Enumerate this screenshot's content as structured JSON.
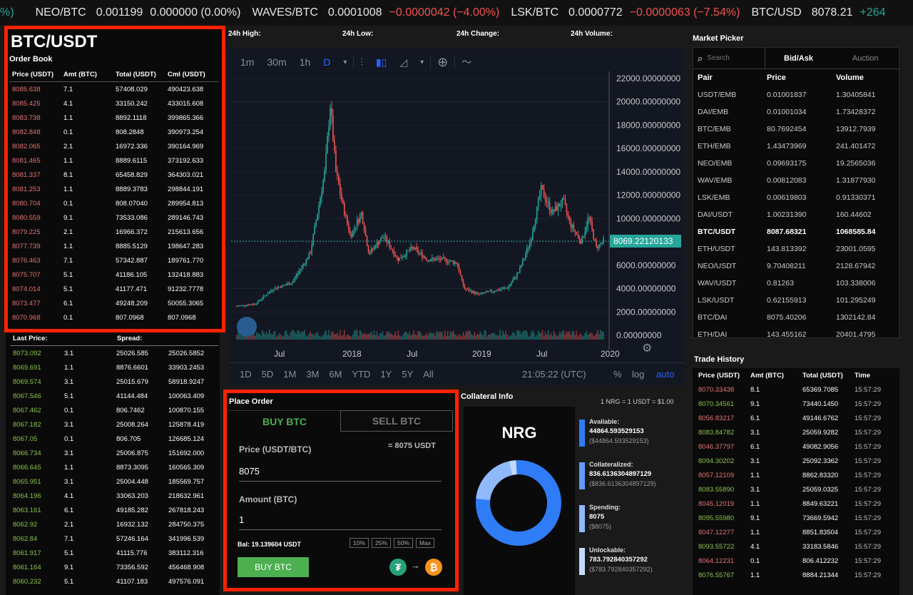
{
  "ticker": [
    {
      "pair": "%)",
      "price": "",
      "change": "",
      "dir": "pos"
    },
    {
      "pair": "NEO/BTC",
      "price": "0.001199",
      "change": "0.000000 (0.00%)",
      "dir": "zero"
    },
    {
      "pair": "WAVES/BTC",
      "price": "0.0001008",
      "change": "−0.0000042 (−4.00%)",
      "dir": "neg"
    },
    {
      "pair": "LSK/BTC",
      "price": "0.0000772",
      "change": "−0.0000063 (−7.54%)",
      "dir": "neg"
    },
    {
      "pair": "BTC/USD",
      "price": "8078.21",
      "change": "+264",
      "dir": "pos"
    }
  ],
  "pair_title": "BTC/USDT",
  "orderbook": {
    "title": "Order Book",
    "headers": [
      "Price (USDT)",
      "Amt (BTC)",
      "Total (USDT)",
      "Cml (USDT)"
    ],
    "asks": [
      [
        "8085.638",
        "7.1",
        "57408.029",
        "490423.638"
      ],
      [
        "8085.425",
        "4.1",
        "33150.242",
        "433015.608"
      ],
      [
        "8083.738",
        "1.1",
        "8892.1118",
        "399865.366"
      ],
      [
        "8082.848",
        "0.1",
        "808.2848",
        "390973.254"
      ],
      [
        "8082.065",
        "2.1",
        "16972.336",
        "390164.969"
      ],
      [
        "8081.465",
        "1.1",
        "8889.6115",
        "373192.633"
      ],
      [
        "8081.337",
        "8.1",
        "65458.829",
        "364303.021"
      ],
      [
        "8081.253",
        "1.1",
        "8889.3783",
        "298844.191"
      ],
      [
        "8080.704",
        "0.1",
        "808.07040",
        "289954.813"
      ],
      [
        "8080.559",
        "9.1",
        "73533.086",
        "289146.743"
      ],
      [
        "8079.225",
        "2.1",
        "16966.372",
        "215613.656"
      ],
      [
        "8077.739",
        "1.1",
        "8885.5129",
        "198647.283"
      ],
      [
        "8076.463",
        "7.1",
        "57342.887",
        "189761.770"
      ],
      [
        "8075.707",
        "5.1",
        "41186.105",
        "132418.883"
      ],
      [
        "8074.014",
        "5.1",
        "41177.471",
        "91232.7778"
      ],
      [
        "8073.477",
        "6.1",
        "49248.209",
        "50055.3065"
      ],
      [
        "8070.968",
        "0.1",
        "807.0968",
        "807.0968"
      ]
    ],
    "last_price_label": "Last Price:",
    "spread_label": "Spread:",
    "bids": [
      [
        "8073.092",
        "3.1",
        "25026.585",
        "25026.5852"
      ],
      [
        "8069.691",
        "1.1",
        "8876.6601",
        "33903.2453"
      ],
      [
        "8069.574",
        "3.1",
        "25015.679",
        "58918.9247"
      ],
      [
        "8067.546",
        "5.1",
        "41144.484",
        "100063.409"
      ],
      [
        "8067.462",
        "0.1",
        "806.7462",
        "100870.155"
      ],
      [
        "8067.182",
        "3.1",
        "25008.264",
        "125878.419"
      ],
      [
        "8067.05",
        "0.1",
        "806.705",
        "126685.124"
      ],
      [
        "8066.734",
        "3.1",
        "25006.875",
        "151692.000"
      ],
      [
        "8066.645",
        "1.1",
        "8873.3095",
        "160565.309"
      ],
      [
        "8065.951",
        "3.1",
        "25004.448",
        "185569.757"
      ],
      [
        "8064.196",
        "4.1",
        "33063.203",
        "218632.961"
      ],
      [
        "8063.161",
        "6.1",
        "49185.282",
        "267818.243"
      ],
      [
        "8062.92",
        "2.1",
        "16932.132",
        "284750.375"
      ],
      [
        "8062.84",
        "7.1",
        "57246.164",
        "341996.539"
      ],
      [
        "8061.917",
        "5.1",
        "41115.776",
        "383112.316"
      ],
      [
        "8061.164",
        "9.1",
        "73356.592",
        "456468.908"
      ],
      [
        "8060.232",
        "5.1",
        "41107.183",
        "497576.091"
      ]
    ]
  },
  "stats": {
    "high": "24h High:",
    "low": "24h Low:",
    "change": "24h Change:",
    "volume": "24h Volume:"
  },
  "chart_toolbar": {
    "intervals": [
      "1m",
      "30m",
      "1h",
      "D"
    ]
  },
  "chart_bottom": {
    "ranges": [
      "1D",
      "5D",
      "1M",
      "3M",
      "6M",
      "YTD",
      "1Y",
      "5Y",
      "All"
    ],
    "time": "21:05:22 (UTC)",
    "pct": "%",
    "log": "log",
    "auto": "auto"
  },
  "chart_data": {
    "type": "candlestick",
    "x_ticks": [
      "Jul",
      "2018",
      "Jul",
      "2019",
      "Jul",
      "2020"
    ],
    "y_ticks": [
      "22000.00000000",
      "20000.00000000",
      "18000.00000000",
      "16000.00000000",
      "14000.00000000",
      "12000.00000000",
      "10000.00000000",
      "8000.00000000",
      "6000.00000000",
      "4000.00000000",
      "2000.00000000",
      "0.00000000"
    ],
    "ylim": [
      0,
      22000
    ],
    "last_price": "8069.22120133",
    "last_price_value": 8069.22,
    "series_approx": [
      {
        "t": 0.0,
        "p": 2500
      },
      {
        "t": 0.05,
        "p": 2700
      },
      {
        "t": 0.1,
        "p": 4000
      },
      {
        "t": 0.15,
        "p": 4500
      },
      {
        "t": 0.2,
        "p": 7000
      },
      {
        "t": 0.24,
        "p": 14000
      },
      {
        "t": 0.255,
        "p": 19800
      },
      {
        "t": 0.27,
        "p": 14000
      },
      {
        "t": 0.29,
        "p": 11000
      },
      {
        "t": 0.31,
        "p": 8500
      },
      {
        "t": 0.34,
        "p": 10500
      },
      {
        "t": 0.36,
        "p": 7000
      },
      {
        "t": 0.4,
        "p": 8500
      },
      {
        "t": 0.44,
        "p": 6500
      },
      {
        "t": 0.48,
        "p": 7500
      },
      {
        "t": 0.52,
        "p": 6500
      },
      {
        "t": 0.56,
        "p": 6500
      },
      {
        "t": 0.6,
        "p": 6200
      },
      {
        "t": 0.62,
        "p": 4000
      },
      {
        "t": 0.66,
        "p": 3500
      },
      {
        "t": 0.7,
        "p": 3800
      },
      {
        "t": 0.74,
        "p": 4100
      },
      {
        "t": 0.77,
        "p": 5500
      },
      {
        "t": 0.8,
        "p": 8000
      },
      {
        "t": 0.83,
        "p": 12500
      },
      {
        "t": 0.86,
        "p": 10500
      },
      {
        "t": 0.89,
        "p": 11500
      },
      {
        "t": 0.91,
        "p": 9500
      },
      {
        "t": 0.94,
        "p": 8000
      },
      {
        "t": 0.96,
        "p": 10200
      },
      {
        "t": 0.98,
        "p": 7500
      },
      {
        "t": 1.0,
        "p": 8070
      }
    ]
  },
  "market_picker": {
    "title": "Market Picker",
    "search_placeholder": "Search",
    "tabs": [
      "Bid/Ask",
      "Auction"
    ],
    "headers": [
      "Pair",
      "Price",
      "Volume"
    ],
    "rows": [
      [
        "USDT/EMB",
        "0.01001837",
        "1.30405841"
      ],
      [
        "DAI/EMB",
        "0.01001034",
        "1.73428372"
      ],
      [
        "BTC/EMB",
        "80.7692454",
        "13912.7939"
      ],
      [
        "ETH/EMB",
        "1.43473969",
        "241.401472"
      ],
      [
        "NEO/EMB",
        "0.09693175",
        "19.2565036"
      ],
      [
        "WAV/EMB",
        "0.00812083",
        "1.31877930"
      ],
      [
        "LSK/EMB",
        "0.00619803",
        "0.91330371"
      ],
      [
        "DAI/USDT",
        "1.00231390",
        "160.44602"
      ],
      [
        "BTC/USDT",
        "8087.68321",
        "1068585.84"
      ],
      [
        "ETH/USDT",
        "143.813392",
        "23001.0595"
      ],
      [
        "NEO/USDT",
        "9.70408211",
        "2128.67942"
      ],
      [
        "WAV/USDT",
        "0.81263",
        "103.338006"
      ],
      [
        "LSK/USDT",
        "0.62155913",
        "101.295249"
      ],
      [
        "BTC/DAI",
        "8075.40206",
        "1302142.84"
      ],
      [
        "ETH/DAI",
        "143.455162",
        "20401.4795"
      ]
    ]
  },
  "place_order": {
    "title": "Place Order",
    "buy_tab": "BUY BTC",
    "sell_tab": "SELL BTC",
    "price_label": "Price (USDT/BTC)",
    "price_equiv": "= 8075 USDT",
    "price_value": "8075",
    "amount_label": "Amount (BTC)",
    "amount_value": "1",
    "balance": "Bal: 19.139604 USDT",
    "pcts": [
      "10%",
      "25%",
      "50%",
      "Max"
    ],
    "submit": "BUY BTC",
    "colors": {
      "buy": "#4caf50",
      "tether": "#26a17b",
      "bitcoin": "#f7931a"
    }
  },
  "collateral": {
    "title": "Collateral Info",
    "rate": "1 NRG = 1 USDT = $1.00",
    "token": "NRG",
    "items": [
      {
        "label": "Available:",
        "value": "44864.593529153",
        "usd": "($44864.593529153)",
        "color": "#2f7cf6"
      },
      {
        "label": "Collateralized:",
        "value": "836.6136304897129",
        "usd": "($836.6136304897129)",
        "color": "#5f9cf8"
      },
      {
        "label": "Spending:",
        "value": "8075",
        "usd": "($8075)",
        "color": "#8fb9fa"
      },
      {
        "label": "Unlockable:",
        "value": "783.792840357292",
        "usd": "($783.792840357292)",
        "color": "#c4dafc"
      }
    ]
  },
  "trade_history": {
    "title": "Trade History",
    "headers": [
      "Price (USDT)",
      "Amt (BTC)",
      "Total (USDT)",
      "Time"
    ],
    "rows": [
      [
        "8070.33438",
        "8.1",
        "65369.7085",
        "15:57:29",
        "sell"
      ],
      [
        "8070.34561",
        "9.1",
        "73440.1450",
        "15:57:29",
        "buy"
      ],
      [
        "8056.83217",
        "6.1",
        "49146.6762",
        "15:57:29",
        "sell"
      ],
      [
        "8083.84782",
        "3.1",
        "25059.9282",
        "15:57:29",
        "buy"
      ],
      [
        "8046.37797",
        "6.1",
        "49082.9056",
        "15:57:29",
        "sell"
      ],
      [
        "8094.30202",
        "3.1",
        "25092.3362",
        "15:57:29",
        "buy"
      ],
      [
        "8057.12109",
        "1.1",
        "8862.83320",
        "15:57:29",
        "sell"
      ],
      [
        "8083.55890",
        "3.1",
        "25059.0325",
        "15:57:29",
        "buy"
      ],
      [
        "8045.12019",
        "1.1",
        "8849.63221",
        "15:57:29",
        "sell"
      ],
      [
        "8095.55980",
        "9.1",
        "73669.5942",
        "15:57:29",
        "buy"
      ],
      [
        "8047.12277",
        "1.1",
        "8851.83504",
        "15:57:29",
        "sell"
      ],
      [
        "8093.55722",
        "4.1",
        "33183.5846",
        "15:57:29",
        "buy"
      ],
      [
        "8064.12231",
        "0.1",
        "806.412232",
        "15:57:29",
        "sell"
      ],
      [
        "8076.55767",
        "1.1",
        "8884.21344",
        "15:57:29",
        "buy"
      ]
    ]
  }
}
